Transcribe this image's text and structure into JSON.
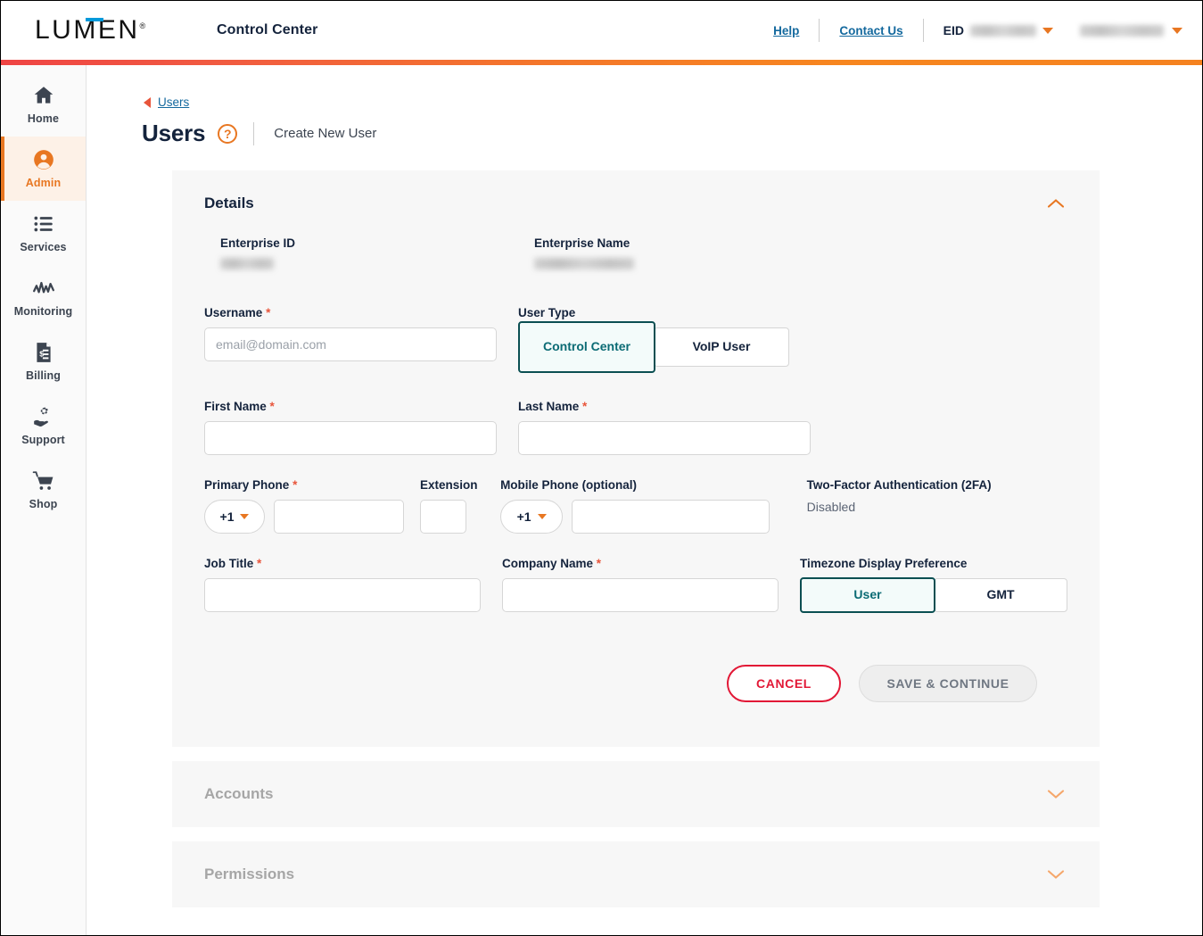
{
  "header": {
    "logo_text": "LUMEN",
    "logo_registered": "®",
    "app_title": "Control Center",
    "help_label": "Help",
    "contact_label": "Contact Us",
    "eid_label": "EID",
    "eid_value_redacted": true,
    "account_value_redacted": true,
    "gradient_from": "#ef4444",
    "gradient_to": "#f58220"
  },
  "sidebar": {
    "items": [
      {
        "label": "Home",
        "icon": "home-icon",
        "active": false
      },
      {
        "label": "Admin",
        "icon": "user-circle-icon",
        "active": true
      },
      {
        "label": "Services",
        "icon": "list-icon",
        "active": false
      },
      {
        "label": "Monitoring",
        "icon": "activity-icon",
        "active": false
      },
      {
        "label": "Billing",
        "icon": "invoice-icon",
        "active": false
      },
      {
        "label": "Support",
        "icon": "support-gear-hand-icon",
        "active": false
      },
      {
        "label": "Shop",
        "icon": "cart-icon",
        "active": false
      }
    ],
    "active_color": "#e87722"
  },
  "breadcrumb": {
    "back_label": "Users"
  },
  "page": {
    "title": "Users",
    "help_glyph": "?",
    "subtitle": "Create New User"
  },
  "details_section": {
    "title": "Details",
    "expanded": true,
    "chevron": "chevron-up",
    "enterprise_id_label": "Enterprise ID",
    "enterprise_name_label": "Enterprise Name",
    "username_label": "Username",
    "username_value": "",
    "username_placeholder": "email@domain.com",
    "user_type_label": "User Type",
    "user_type_options": [
      "Control Center",
      "VoIP User"
    ],
    "user_type_selected": "Control Center",
    "first_name_label": "First Name",
    "first_name_value": "",
    "last_name_label": "Last Name",
    "last_name_value": "",
    "primary_phone_label": "Primary Phone",
    "primary_phone_cc": "+1",
    "primary_phone_value": "",
    "extension_label": "Extension",
    "extension_value": "",
    "mobile_phone_label": "Mobile Phone (optional)",
    "mobile_phone_cc": "+1",
    "mobile_phone_value": "",
    "twofa_label": "Two-Factor Authentication (2FA)",
    "twofa_value": "Disabled",
    "job_title_label": "Job Title",
    "job_title_value": "",
    "company_name_label": "Company Name",
    "company_name_value": "",
    "timezone_label": "Timezone Display Preference",
    "timezone_options": [
      "User",
      "GMT"
    ],
    "timezone_selected": "User",
    "required_marker": "*"
  },
  "actions": {
    "cancel_label": "CANCEL",
    "save_label": "SAVE & CONTINUE",
    "save_disabled": true
  },
  "accounts_section": {
    "title": "Accounts",
    "expanded": false,
    "chevron": "chevron-down"
  },
  "permissions_section": {
    "title": "Permissions",
    "expanded": false,
    "chevron": "chevron-down"
  }
}
